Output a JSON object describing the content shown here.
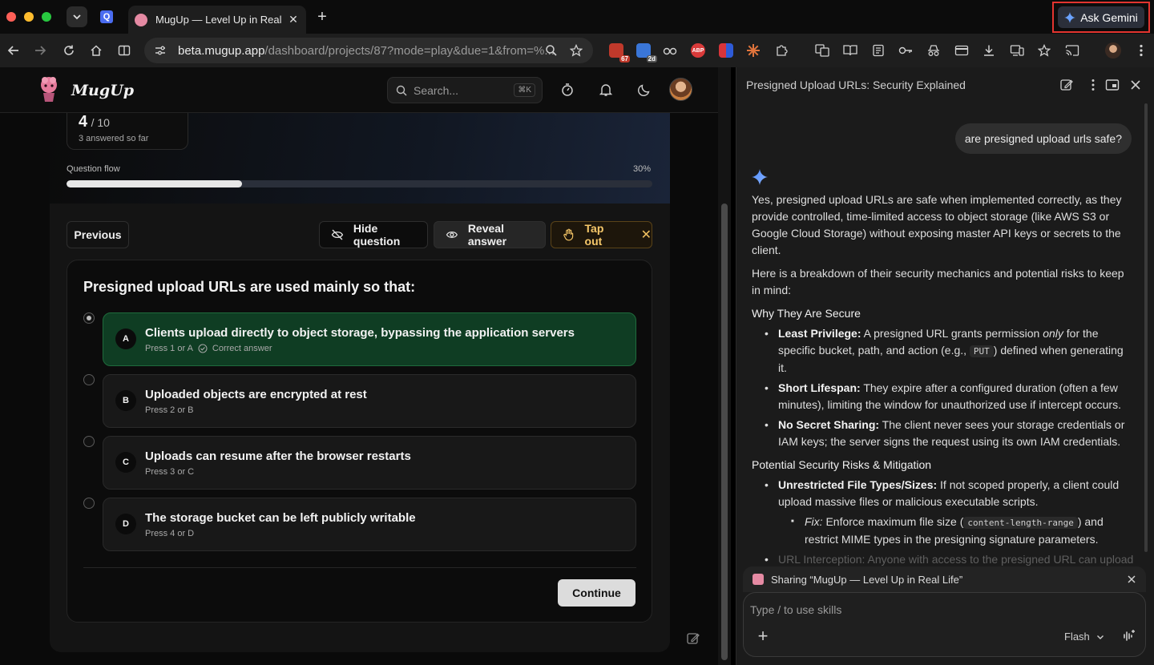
{
  "browser": {
    "active_tab_title": "MugUp — Level Up in Real Life",
    "ask_gemini_label": "Ask Gemini",
    "url_host": "beta.mugup.app",
    "url_path": "/dashboard/projects/87?mode=play&due=1&from=%...",
    "extension_badges": {
      "mail": "67",
      "calendar": "2d",
      "adblock": "ABP"
    }
  },
  "app": {
    "logo_text": "MugUp",
    "search_placeholder": "Search...",
    "search_shortcut": "⌘K"
  },
  "progress": {
    "count": "4",
    "total": "/ 10",
    "answered_text": "3 answered so far",
    "flow_label": "Question flow",
    "flow_percent_label": "30%",
    "flow_fraction": 0.3
  },
  "controls": {
    "previous": "Previous",
    "hide_question": "Hide question",
    "reveal_answer": "Reveal answer",
    "tap_out": "Tap out",
    "continue": "Continue"
  },
  "question": {
    "text": "Presigned upload URLs are used mainly so that:",
    "options": [
      {
        "letter": "A",
        "label": "Clients upload directly to object storage, bypassing the application servers",
        "hint": "Press 1 or A",
        "status": "Correct answer",
        "correct": true
      },
      {
        "letter": "B",
        "label": "Uploaded objects are encrypted at rest",
        "hint": "Press 2 or B"
      },
      {
        "letter": "C",
        "label": "Uploads can resume after the browser restarts",
        "hint": "Press 3 or C"
      },
      {
        "letter": "D",
        "label": "The storage bucket can be left publicly writable",
        "hint": "Press 4 or D"
      }
    ]
  },
  "gemini": {
    "title": "Presigned Upload URLs: Security Explained",
    "user_message": "are presigned upload urls safe?",
    "intro": "Yes, presigned upload URLs are safe when implemented correctly, as they provide controlled, time-limited access to object storage (like AWS S3 or Google Cloud Storage) without exposing master API keys or secrets to the client.",
    "breakdown": "Here is a breakdown of their security mechanics and potential risks to keep in mind:",
    "secure_heading": "Why They Are Secure",
    "secure": [
      {
        "term": "Least Privilege:",
        "pre": "A presigned URL grants permission",
        "em": "only",
        "post": "for the specific bucket, path, and action (e.g.,",
        "code": "PUT",
        "tail": ") defined when generating it."
      },
      {
        "term": "Short Lifespan:",
        "text": "They expire after a configured duration (often a few minutes), limiting the window for unauthorized use if intercept occurs."
      },
      {
        "term": "No Secret Sharing:",
        "text": "The client never sees your storage credentials or IAM keys; the server signs the request using its own IAM credentials."
      }
    ],
    "risks_heading": "Potential Security Risks & Mitigation",
    "risk1_term": "Unrestricted File Types/Sizes:",
    "risk1_text": "If not scoped properly, a client could upload massive files or malicious executable scripts.",
    "fix_label": "Fix:",
    "fix_pre": "Enforce maximum file size (",
    "fix_code": "content-length-range",
    "fix_post": ") and restrict MIME types in the presigning signature parameters.",
    "risk2_faded": "URL Interception: Anyone with access to the presigned URL can upload",
    "share_text": "Sharing “MugUp — Level Up in Real Life”",
    "composer_placeholder": "Type / to use skills",
    "model": "Flash"
  }
}
